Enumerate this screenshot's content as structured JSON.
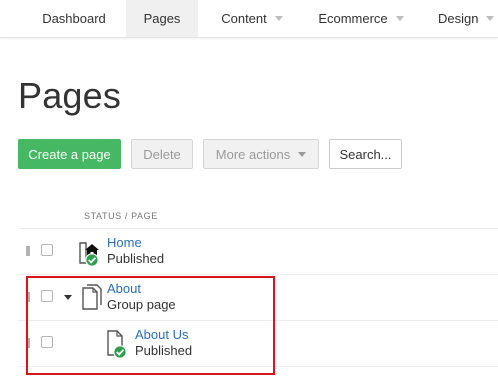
{
  "nav": {
    "items": [
      {
        "label": "Dashboard",
        "dropdown": false,
        "active": false
      },
      {
        "label": "Pages",
        "dropdown": false,
        "active": true
      },
      {
        "label": "Content",
        "dropdown": true,
        "active": false
      },
      {
        "label": "Ecommerce",
        "dropdown": true,
        "active": false
      },
      {
        "label": "Design",
        "dropdown": true,
        "active": false
      }
    ]
  },
  "page": {
    "title": "Pages"
  },
  "toolbar": {
    "create_label": "Create a page",
    "delete_label": "Delete",
    "more_label": "More actions",
    "search_label": "Search..."
  },
  "list": {
    "header": "STATUS / PAGE",
    "rows": [
      {
        "title": "Home",
        "status": "Published",
        "icon": "home-page-icon",
        "badge": "published-check-icon"
      },
      {
        "title": "About",
        "status": "Group page",
        "icon": "group-page-icon",
        "expanded": true
      },
      {
        "title": "About Us",
        "status": "Published",
        "icon": "page-icon",
        "badge": "published-check-icon"
      }
    ]
  },
  "colors": {
    "primary": "#46b762",
    "link": "#2a6ebb",
    "published": "#2f9e4f",
    "highlight": "#d6151c"
  }
}
